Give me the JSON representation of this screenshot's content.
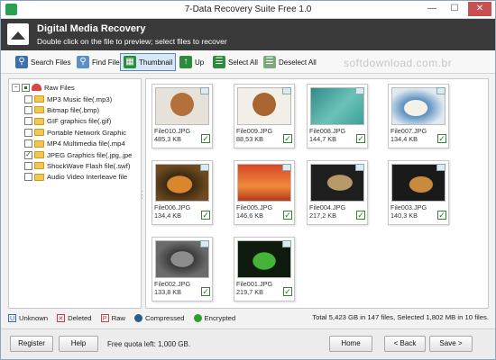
{
  "window": {
    "title": "7-Data Recovery Suite Free 1.0",
    "minimize": "—",
    "maximize": "☐",
    "close": "✕"
  },
  "header": {
    "title": "Digital Media Recovery",
    "subtitle": "Double click on the file to preview; select files to recover"
  },
  "toolbar": {
    "search": "Search Files",
    "find": "Find File",
    "thumbnail": "Thumbnail",
    "up": "Up",
    "select_all": "Select All",
    "deselect_all": "Deselect All"
  },
  "watermark": "softdownload.com.br",
  "tree": {
    "root": "Raw Files",
    "items": [
      "MP3 Music file(.mp3)",
      "Bitmap file(.bmp)",
      "GIF graphics file(.gif)",
      "Portable Network Graphic",
      "MP4 Multimedia file(.mp4",
      "JPEG Graphics file(.jpg,.jpe",
      "ShockWave Flash file(.swf)",
      "Audio Video Interleave file"
    ],
    "checked_index": 5
  },
  "files": [
    {
      "name": "File010.JPG",
      "size": "485,3 KB",
      "thumb": "dog1"
    },
    {
      "name": "File009.JPG",
      "size": "88,53 KB",
      "thumb": "dog2"
    },
    {
      "name": "File008.JPG",
      "size": "144,7 KB",
      "thumb": "teal"
    },
    {
      "name": "File007.JPG",
      "size": "134,4 KB",
      "thumb": "bear"
    },
    {
      "name": "File006.JPG",
      "size": "134,4 KB",
      "thumb": "tiger"
    },
    {
      "name": "File005.JPG",
      "size": "146,6 KB",
      "thumb": "desert"
    },
    {
      "name": "File004.JPG",
      "size": "217,2 KB",
      "thumb": "cat"
    },
    {
      "name": "File003.JPG",
      "size": "140,3 KB",
      "thumb": "eagle"
    },
    {
      "name": "File002.JPG",
      "size": "133,8 KB",
      "thumb": "wolf"
    },
    {
      "name": "File001.JPG",
      "size": "219,7 KB",
      "thumb": "lizard"
    }
  ],
  "legend": {
    "unknown": "Unknown",
    "deleted": "Deleted",
    "raw": "Raw",
    "compressed": "Compressed",
    "encrypted": "Encrypted",
    "total": "Total 5,423 GB in 147 files, Selected 1,802 MB in 10 files."
  },
  "bottom": {
    "register": "Register",
    "help": "Help",
    "quota": "Free quota left: 1,000 GB.",
    "home": "Home",
    "back": "< Back",
    "save": "Save >"
  },
  "colors": {
    "header_bg": "#3a3a3a",
    "toolbar_active": "#d6e7f7",
    "check_green": "#1b7a1b"
  }
}
